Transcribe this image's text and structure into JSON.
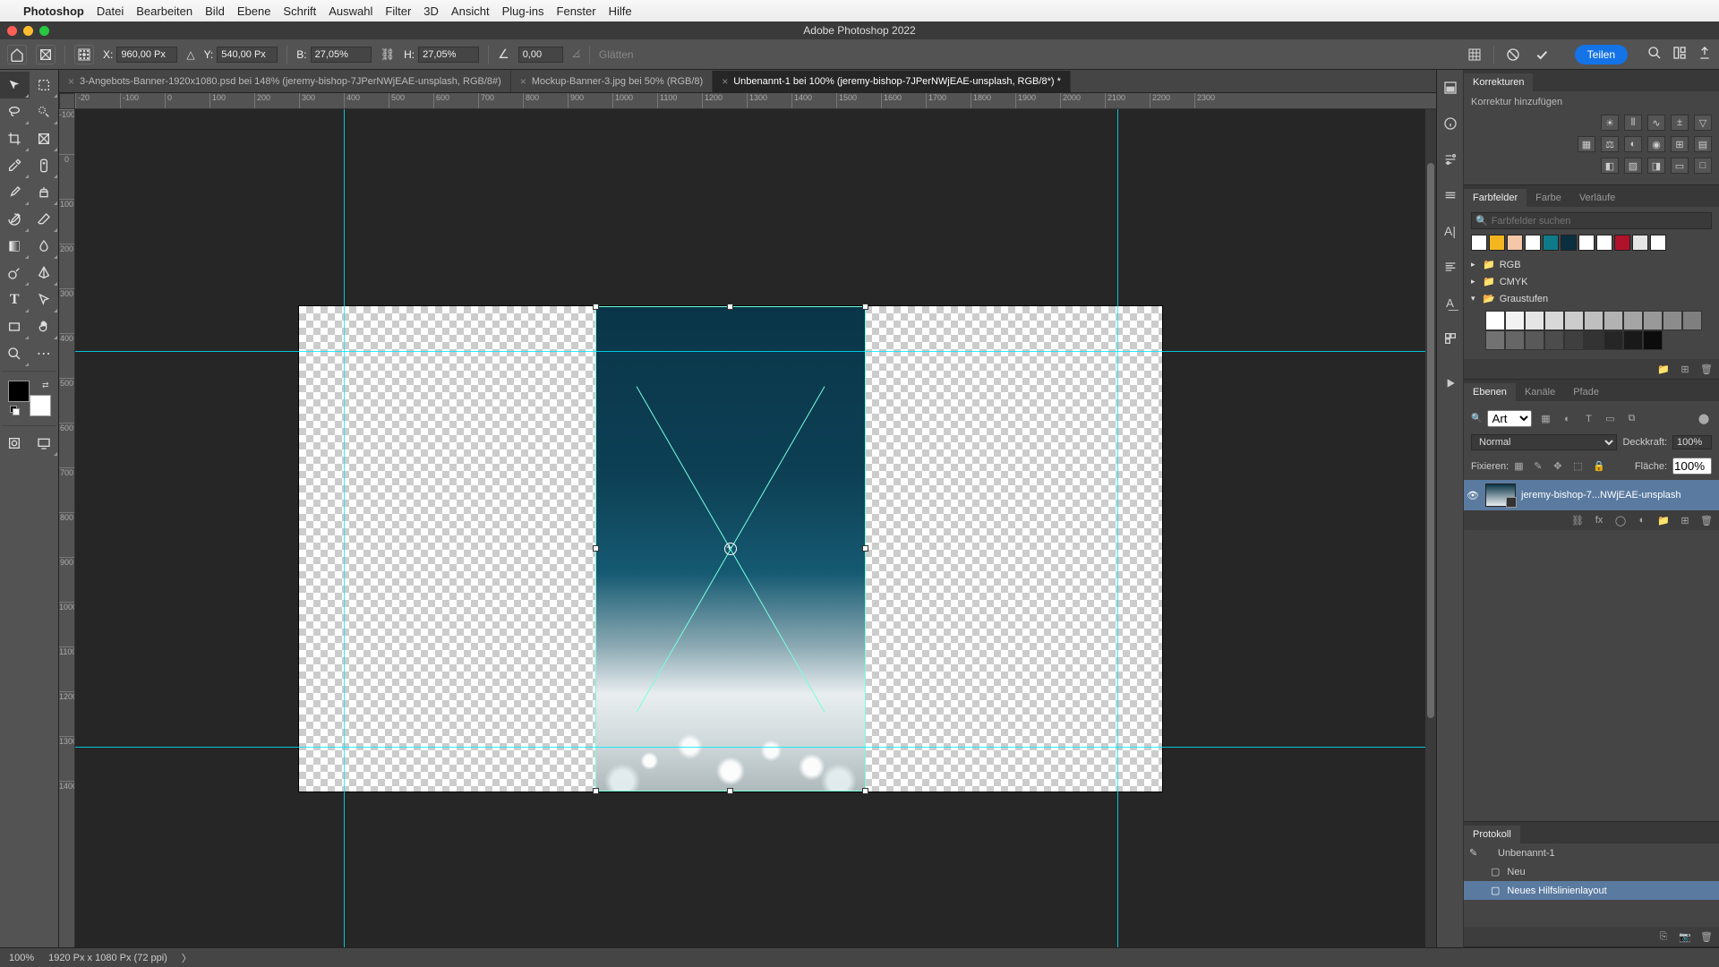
{
  "mac_menu": {
    "app": "Photoshop",
    "items": [
      "Datei",
      "Bearbeiten",
      "Bild",
      "Ebene",
      "Schrift",
      "Auswahl",
      "Filter",
      "3D",
      "Ansicht",
      "Plug-ins",
      "Fenster",
      "Hilfe"
    ]
  },
  "window_title": "Adobe Photoshop 2022",
  "options_bar": {
    "x_label": "X:",
    "x_value": "960,00 Px",
    "y_label": "Y:",
    "y_value": "540,00 Px",
    "w_label": "B:",
    "w_value": "27,05%",
    "h_label": "H:",
    "h_value": "27,05%",
    "rot_value": "0,00",
    "interp_label": "Glätten",
    "share": "Teilen"
  },
  "doc_tabs": [
    {
      "label": "3-Angebots-Banner-1920x1080.psd bei 148% (jeremy-bishop-7JPerNWjEAE-unsplash, RGB/8#)",
      "active": false
    },
    {
      "label": "Mockup-Banner-3.jpg bei 50% (RGB/8)",
      "active": false
    },
    {
      "label": "Unbenannt-1 bei 100% (jeremy-bishop-7JPerNWjEAE-unsplash, RGB/8*) *",
      "active": true
    }
  ],
  "ruler_h": [
    "-20",
    "-100",
    "0",
    "100",
    "200",
    "300",
    "400",
    "500",
    "600",
    "700",
    "800",
    "900",
    "1000",
    "1100",
    "1200",
    "1300",
    "1400",
    "1500",
    "1600",
    "1700",
    "1800",
    "1900",
    "2000",
    "2100",
    "2200",
    "2300"
  ],
  "ruler_v": [
    "-100",
    "0",
    "100",
    "200",
    "300",
    "400",
    "500",
    "600",
    "700",
    "800",
    "900",
    "1000",
    "1100",
    "1200",
    "1300",
    "1400"
  ],
  "panels": {
    "adjustments": {
      "tab": "Korrekturen",
      "add_label": "Korrektur hinzufügen"
    },
    "swatches": {
      "tabs": [
        "Farbfelder",
        "Farbe",
        "Verläufe"
      ],
      "search_placeholder": "Farbfelder suchen",
      "recent_colors": [
        "#ffffff",
        "#f3b61f",
        "#f4c7a8",
        "#ffffff",
        "#0e7a8a",
        "#0a2f40",
        "#ffffff",
        "#ffffff",
        "#b0122b",
        "#e5e5e5",
        "#ffffff"
      ],
      "folders": {
        "rgb": "RGB",
        "cmyk": "CMYK",
        "gray": "Graustufen"
      },
      "grays": [
        "#ffffff",
        "#f2f2f2",
        "#e5e5e5",
        "#d8d8d8",
        "#cccccc",
        "#bfbfbf",
        "#b2b2b2",
        "#a5a5a5",
        "#999999",
        "#8c8c8c",
        "#7f7f7f",
        "#727272",
        "#666666",
        "#595959",
        "#4c4c4c",
        "#3f3f3f",
        "#333333",
        "#262626",
        "#191919",
        "#0c0c0c"
      ]
    },
    "layers": {
      "tabs": [
        "Ebenen",
        "Kanäle",
        "Pfade"
      ],
      "filter_placeholder": "Art",
      "blend_mode": "Normal",
      "opacity_label": "Deckkraft:",
      "opacity_value": "100%",
      "lock_label": "Fixieren:",
      "fill_label": "Fläche:",
      "fill_value": "100%",
      "layer_name": "jeremy-bishop-7...NWjEAE-unsplash"
    },
    "history": {
      "tab": "Protokoll",
      "doc": "Unbenannt-1",
      "items": [
        "Neu",
        "Neues Hilfslinienlayout"
      ]
    }
  },
  "status": {
    "zoom": "100%",
    "doc_info": "1920 Px x 1080 Px (72 ppi)"
  }
}
